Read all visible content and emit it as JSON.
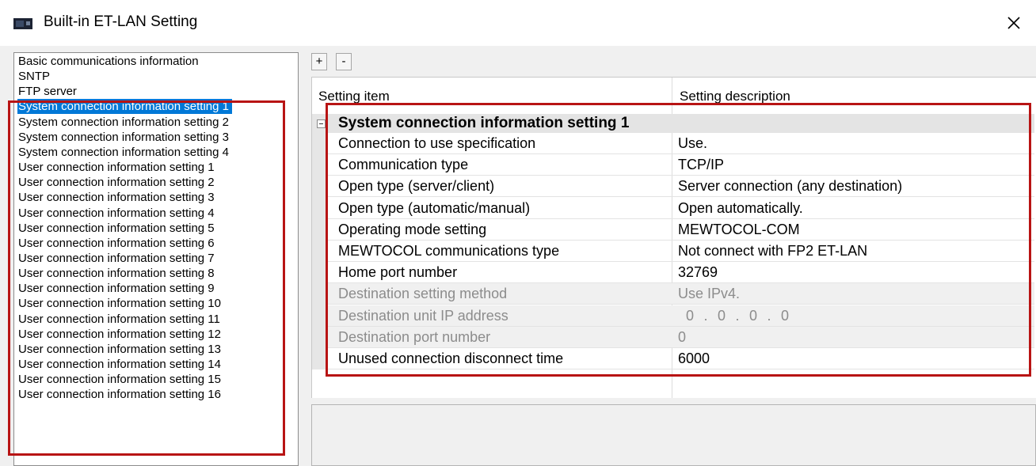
{
  "window": {
    "title": "Built-in ET-LAN Setting",
    "close_icon": "close-icon",
    "app_icon": "plc-icon"
  },
  "left_list": {
    "selected_index": 3,
    "items": [
      "Basic communications information",
      "SNTP",
      "FTP server",
      "System connection information setting 1",
      "System connection information setting 2",
      "System connection information setting 3",
      "System connection information setting 4",
      "User connection information setting 1",
      "User connection information setting 2",
      "User connection information setting 3",
      "User connection information setting 4",
      "User connection information setting 5",
      "User connection information setting 6",
      "User connection information setting 7",
      "User connection information setting 8",
      "User connection information setting 9",
      "User connection information setting 10",
      "User connection information setting 11",
      "User connection information setting 12",
      "User connection information setting 13",
      "User connection information setting 14",
      "User connection information setting 15",
      "User connection information setting 16"
    ]
  },
  "toolbar": {
    "expand_label": "+",
    "collapse_label": "-"
  },
  "grid": {
    "header_item": "Setting item",
    "header_desc": "Setting description",
    "group_title": "System connection information setting 1",
    "rows": [
      {
        "label": "Connection to use specification",
        "value": "Use.",
        "enabled": true
      },
      {
        "label": "Communication type",
        "value": "TCP/IP",
        "enabled": true
      },
      {
        "label": "Open type (server/client)",
        "value": "Server connection (any destination)",
        "enabled": true
      },
      {
        "label": "Open type (automatic/manual)",
        "value": "Open automatically.",
        "enabled": true
      },
      {
        "label": "Operating mode setting",
        "value": "MEWTOCOL-COM",
        "enabled": true
      },
      {
        "label": "MEWTOCOL communications type",
        "value": "Not connect with FP2 ET-LAN",
        "enabled": true
      },
      {
        "label": "Home port number",
        "value": "32769",
        "enabled": true
      },
      {
        "label": "Destination setting method",
        "value": "Use IPv4.",
        "enabled": false
      },
      {
        "label": "Destination unit IP address",
        "ip": [
          "0",
          "0",
          "0",
          "0"
        ],
        "enabled": false
      },
      {
        "label": "Destination port number",
        "value": "0",
        "enabled": false
      },
      {
        "label": "Unused connection disconnect time",
        "value": "6000",
        "enabled": true
      }
    ]
  },
  "colors": {
    "highlight": "#b81414",
    "selection": "#0078d7"
  }
}
